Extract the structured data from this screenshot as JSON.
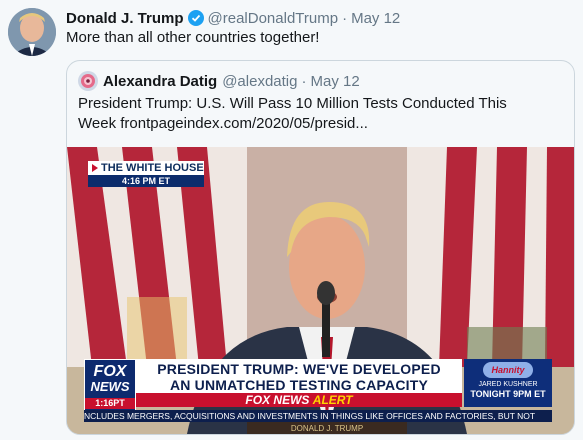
{
  "tweet": {
    "author_name": "Donald J. Trump",
    "handle": "@realDonaldTrump",
    "separator": "·",
    "date": "May 12",
    "text": "More than all other countries together!",
    "verified_icon": "verified-badge-icon"
  },
  "quoted_tweet": {
    "author_name": "Alexandra Datig",
    "handle": "@alexdatig",
    "separator": "·",
    "date": "May 12",
    "text_line1": "President Trump: U.S. Will Pass 10 Million Tests Conducted This",
    "text_line2": "Week frontpageindex.com/2020/05/presid..."
  },
  "media": {
    "location_label": "THE WHITE HOUSE",
    "time_label": "4:16 PM ET",
    "network_logo_line1": "FOX",
    "network_logo_line2": "NEWS",
    "network_logo_time": "1:16PT",
    "headline_line1": "PRESIDENT TRUMP: WE'VE DEVELOPED",
    "headline_line2": "AN UNMATCHED TESTING CAPACITY",
    "alert_prefix": "FOX NEWS",
    "alert_word": "ALERT",
    "promo_show": "Hannity",
    "promo_guest": "JARED KUSHNER",
    "promo_time": "TONIGHT 9PM ET",
    "ticker": "NCLUDES MERGERS, ACQUISITIONS AND INVESTMENTS IN THINGS LIKE OFFICES AND FACTORIES, BUT NOT",
    "podium_seal": "DONALD J. TRUMP"
  },
  "colors": {
    "verified": "#1da1f2",
    "muted_text": "#657786",
    "border": "#ccd6dd",
    "fox_navy": "#0d2a6e",
    "fox_red": "#c8102e"
  }
}
